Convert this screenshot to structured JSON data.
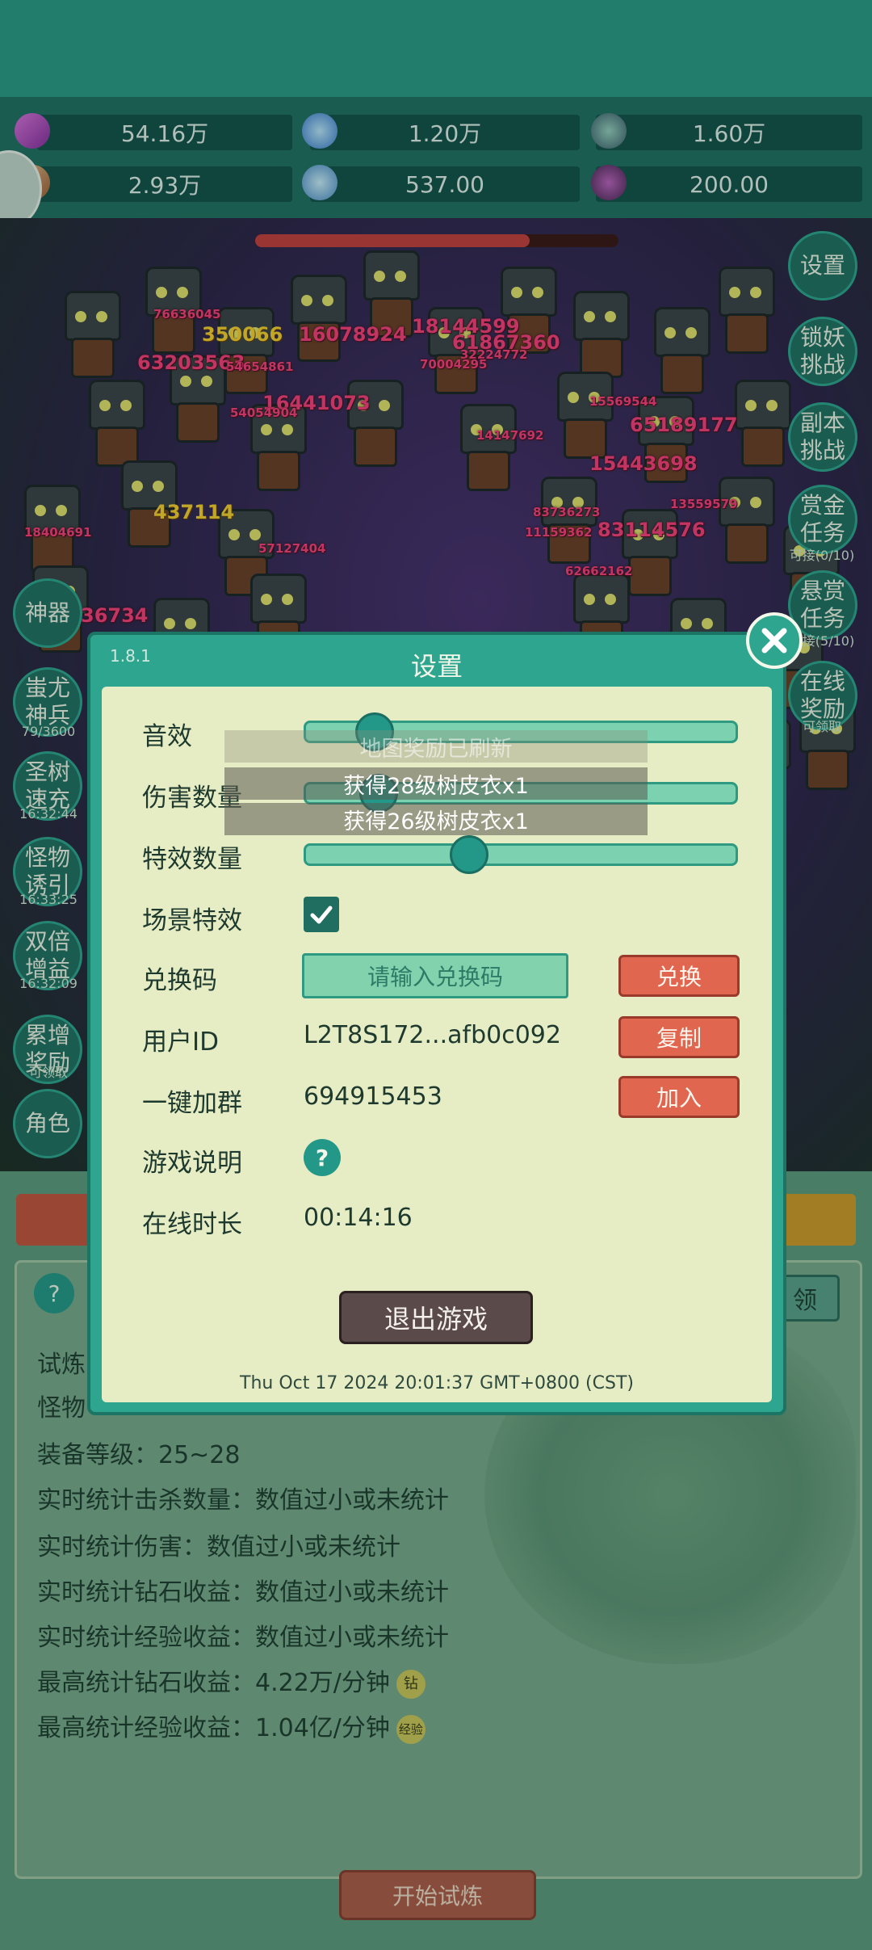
{
  "resources": [
    {
      "icon": "purple-gem-icon",
      "value": "54.16万"
    },
    {
      "icon": "blue-crystal-icon",
      "value": "1.20万"
    },
    {
      "icon": "globe-orb-icon",
      "value": "1.60万"
    },
    {
      "icon": "horn-icon",
      "value": "2.93万"
    },
    {
      "icon": "ice-shard-icon",
      "value": "537.00"
    },
    {
      "icon": "purple-pot-icon",
      "value": "200.00"
    }
  ],
  "damage_numbers": [
    {
      "text": "76636045",
      "style": "s"
    },
    {
      "text": "350066",
      "style": "y"
    },
    {
      "text": "16078924",
      "style": ""
    },
    {
      "text": "18144599",
      "style": ""
    },
    {
      "text": "61867360",
      "style": ""
    },
    {
      "text": "32224772",
      "style": "s"
    },
    {
      "text": "63203563",
      "style": ""
    },
    {
      "text": "54654861",
      "style": "s"
    },
    {
      "text": "70004295",
      "style": "s"
    },
    {
      "text": "16441073",
      "style": ""
    },
    {
      "text": "54054904",
      "style": "s"
    },
    {
      "text": "15569544",
      "style": "s"
    },
    {
      "text": "65189177",
      "style": ""
    },
    {
      "text": "14147692",
      "style": "s"
    },
    {
      "text": "15443698",
      "style": ""
    },
    {
      "text": "437114",
      "style": "y"
    },
    {
      "text": "18404691",
      "style": "s"
    },
    {
      "text": "57127404",
      "style": "s"
    },
    {
      "text": "83736273",
      "style": "s"
    },
    {
      "text": "13559579",
      "style": "s"
    },
    {
      "text": "11159362",
      "style": "s"
    },
    {
      "text": "83114576",
      "style": ""
    },
    {
      "text": "62662162",
      "style": "s"
    },
    {
      "text": "36734",
      "style": ""
    }
  ],
  "right_buttons": [
    {
      "label": "设置",
      "sub": ""
    },
    {
      "label": "锁妖挑战",
      "sub": ""
    },
    {
      "label": "副本挑战",
      "sub": ""
    },
    {
      "label": "赏金任务",
      "sub": "可接(0/10)"
    },
    {
      "label": "悬赏任务",
      "sub": "可接(5/10)"
    },
    {
      "label": "在线奖励",
      "sub": "可领取"
    }
  ],
  "left_buttons": [
    {
      "label": "神器",
      "sub": ""
    },
    {
      "label": "蚩尤神兵",
      "sub": "79/3600"
    },
    {
      "label": "圣树速充",
      "sub": "16:32:44"
    },
    {
      "label": "怪物诱引",
      "sub": "16:33:25"
    },
    {
      "label": "双倍增益",
      "sub": "16:32:09"
    },
    {
      "label": "累增奖励",
      "sub": "可领取"
    },
    {
      "label": "角色",
      "sub": ""
    }
  ],
  "lower": {
    "help": "?",
    "right_tab": "领",
    "lines": [
      "试炼",
      "怪物",
      "装备等级：25~28",
      "实时统计击杀数量：数值过小或未统计",
      "实时统计伤害：数值过小或未统计",
      "实时统计钻石收益：数值过小或未统计",
      "实时统计经验收益：数值过小或未统计",
      "最高统计钻石收益：4.22万/分钟",
      "最高统计经验收益：1.04亿/分钟"
    ],
    "badge_diamond": "钻",
    "badge_exp": "经验",
    "start_button": "开始试炼"
  },
  "settings": {
    "version": "1.8.1",
    "title": "设置",
    "sound_label": "音效",
    "damage_count_label": "伤害数量",
    "effects_count_label": "特效数量",
    "scene_effects_label": "场景特效",
    "redeem_label": "兑换码",
    "redeem_placeholder": "请输入兑换码",
    "redeem_button": "兑换",
    "user_id_label": "用户ID",
    "user_id_value": "L2T8S172...afb0c092",
    "copy_button": "复制",
    "group_label": "一键加群",
    "group_value": "694915453",
    "join_button": "加入",
    "guide_label": "游戏说明",
    "guide_button": "?",
    "online_label": "在线时长",
    "online_value": "00:14:16",
    "exit_button": "退出游戏",
    "timestamp": "Thu Oct 17 2024 20:01:37 GMT+0800 (CST)",
    "sound_level": 0.13,
    "damage_level": 0.14,
    "effects_level": 0.37,
    "scene_effects_checked": true
  },
  "toasts": [
    "地图奖励已刷新",
    "获得28级树皮衣x1",
    "获得26级树皮衣x1"
  ]
}
